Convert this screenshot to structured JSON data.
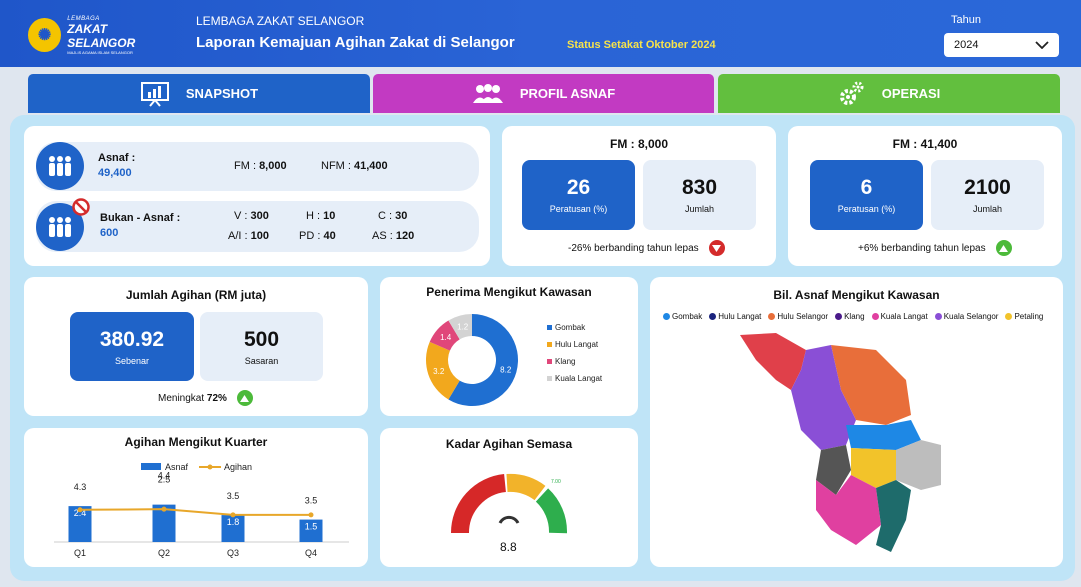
{
  "header": {
    "logo_small": "LEMBAGA",
    "logo_big": "ZAKAT SELANGOR",
    "logo_sub": "MAJLIS AGAMA ISLAM SELANGOR",
    "org": "LEMBAGA ZAKAT SELANGOR",
    "report_title": "Laporan Kemajuan Agihan Zakat di Selangor",
    "status": "Status Setakat Oktober 2024",
    "year_label": "Tahun",
    "year_value": "2024"
  },
  "tabs": [
    {
      "label": "SNAPSHOT",
      "color": "#1f63c8"
    },
    {
      "label": "PROFIL ASNAF",
      "color": "#c23ac2"
    },
    {
      "label": "OPERASI",
      "color": "#62bf3e"
    }
  ],
  "asnaf": {
    "label": "Asnaf :",
    "value": "49,400",
    "fm_label": "FM :",
    "fm_value": "8,000",
    "nfm_label": "NFM :",
    "nfm_value": "41,400"
  },
  "bukan": {
    "label": "Bukan - Asnaf :",
    "value": "600",
    "v_label": "V :",
    "v_value": "300",
    "h_label": "H :",
    "h_value": "10",
    "c_label": "C :",
    "c_value": "30",
    "ai_label": "A/I :",
    "ai_value": "100",
    "pd_label": "PD :",
    "pd_value": "40",
    "as_label": "AS :",
    "as_value": "120"
  },
  "fm1": {
    "title": "FM : 8,000",
    "pct": "26",
    "pct_label": "Peratusan (%)",
    "count": "830",
    "count_label": "Jumlah",
    "compare": "-26% berbanding tahun lepas",
    "trend": "down"
  },
  "fm2": {
    "title": "FM : 41,400",
    "pct": "6",
    "pct_label": "Peratusan (%)",
    "count": "2100",
    "count_label": "Jumlah",
    "compare": "+6% berbanding tahun lepas",
    "trend": "up"
  },
  "agihan": {
    "title": "Jumlah Agihan (RM juta)",
    "actual": "380.92",
    "actual_label": "Sebenar",
    "target": "500",
    "target_label": "Sasaran",
    "increase_label": "Meningkat",
    "increase_value": "72%"
  },
  "penerima": {
    "title": "Penerima Mengikut Kawasan"
  },
  "kuarter": {
    "title": "Agihan Mengikut Kuarter"
  },
  "kadar": {
    "title": "Kadar Agihan Semasa",
    "value": "8.8",
    "max_label": "7.00"
  },
  "peta": {
    "title": "Bil. Asnaf Mengikut Kawasan",
    "legend": [
      {
        "name": "Gombak",
        "color": "#1e88e5"
      },
      {
        "name": "Hulu Langat",
        "color": "#1a237e"
      },
      {
        "name": "Hulu Selangor",
        "color": "#e86e3a"
      },
      {
        "name": "Klang",
        "color": "#4a1a8a"
      },
      {
        "name": "Kuala Langat",
        "color": "#e040a0"
      },
      {
        "name": "Kuala Selangor",
        "color": "#8a4fd6"
      },
      {
        "name": "Petaling",
        "color": "#f2c32a"
      }
    ]
  },
  "chart_data": [
    {
      "type": "pie",
      "title": "Penerima Mengikut Kawasan",
      "categories": [
        "Gombak",
        "Hulu Langat",
        "Klang",
        "Kuala Langat"
      ],
      "values": [
        8.2,
        3.2,
        1.4,
        1.2
      ],
      "colors": [
        "#1f6fd1",
        "#f2a81d",
        "#e0477a",
        "#d3d3d3"
      ],
      "legend": "right"
    },
    {
      "type": "bar",
      "title": "Agihan Mengikut Kuarter",
      "categories": [
        "Q1",
        "Q2",
        "Q3",
        "Q4"
      ],
      "series": [
        {
          "name": "Asnaf",
          "type": "bar",
          "values": [
            2.4,
            2.5,
            1.8,
            1.5
          ],
          "color": "#1f6fd1"
        },
        {
          "name": "Agihan",
          "type": "line",
          "values": [
            4.3,
            4.4,
            3.5,
            3.5
          ],
          "color": "#e8a72a"
        }
      ],
      "legend": "top"
    }
  ]
}
